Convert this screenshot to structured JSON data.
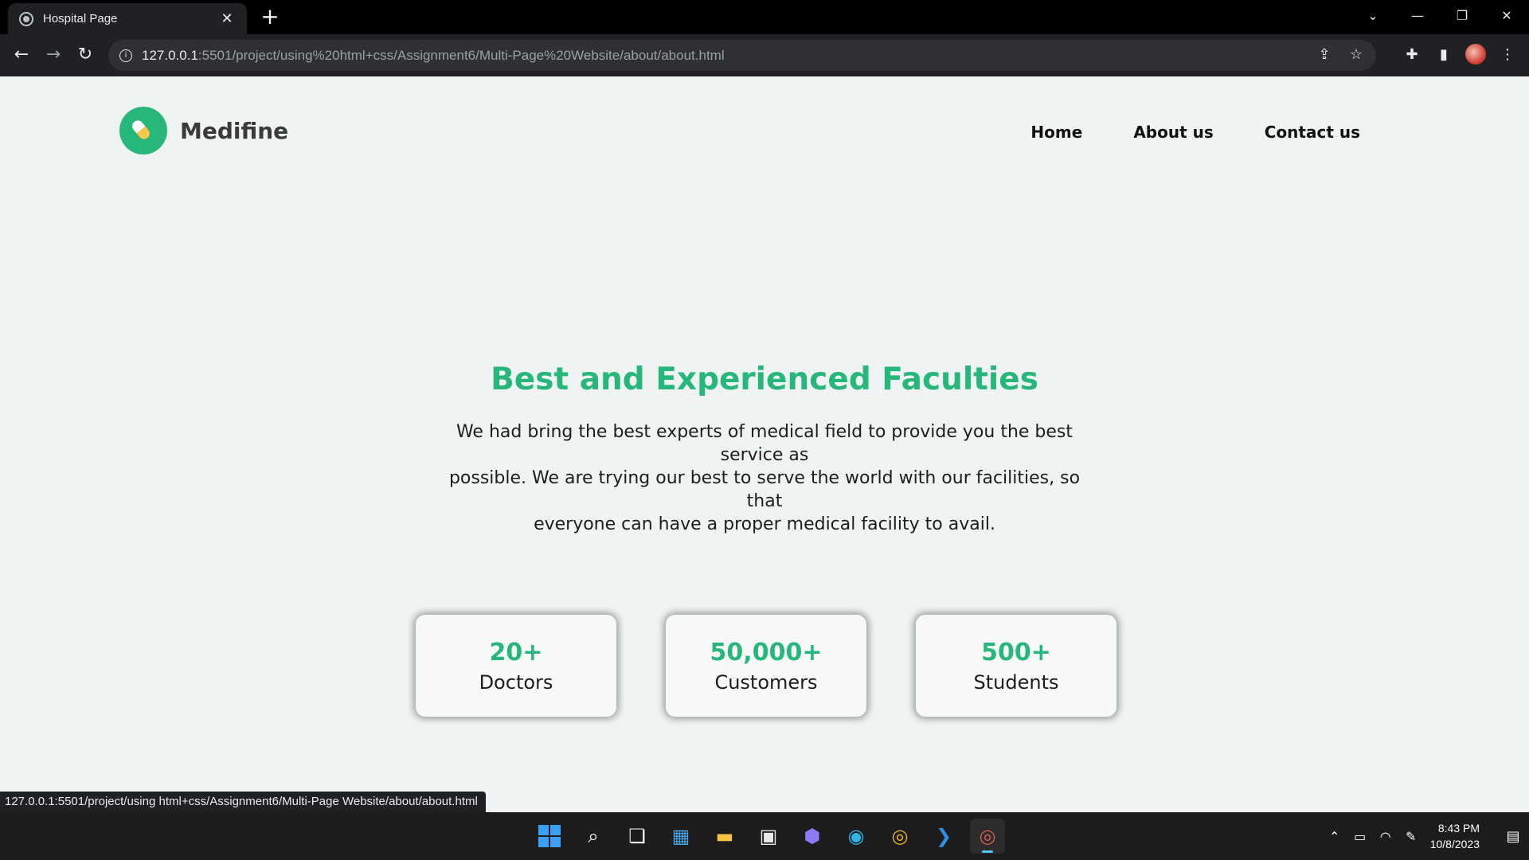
{
  "browser": {
    "tab_title": "Hospital Page",
    "url_host": "127.0.0.1",
    "url_path": ":5501/project/using%20html+css/Assignment6/Multi-Page%20Website/about/about.html",
    "status_url": "127.0.0.1:5501/project/using html+css/Assignment6/Multi-Page Website/about/about.html"
  },
  "site": {
    "brand": "Medifine",
    "nav": [
      {
        "label": "Home"
      },
      {
        "label": "About us"
      },
      {
        "label": "Contact us"
      }
    ],
    "accent_color": "#27b77a"
  },
  "about": {
    "heading": "Best and Experienced Faculties",
    "description_lines": [
      "We had bring the best experts of medical field to provide you the best service as",
      "possible. We are trying our best to serve the world with our facilities, so that",
      "everyone can have a proper medical facility to avail."
    ],
    "stats": [
      {
        "value": "20+",
        "label": "Doctors"
      },
      {
        "value": "50,000+",
        "label": "Customers"
      },
      {
        "value": "500+",
        "label": "Students"
      }
    ]
  },
  "taskbar": {
    "time": "8:43 PM",
    "date": "10/8/2023",
    "apps": [
      "start-icon",
      "search-icon",
      "task-view-icon",
      "widgets-icon",
      "file-explorer-icon",
      "store-icon",
      "copilot-icon",
      "edge-icon",
      "chrome-icon",
      "vscode-icon",
      "chrome-profile-icon"
    ]
  }
}
